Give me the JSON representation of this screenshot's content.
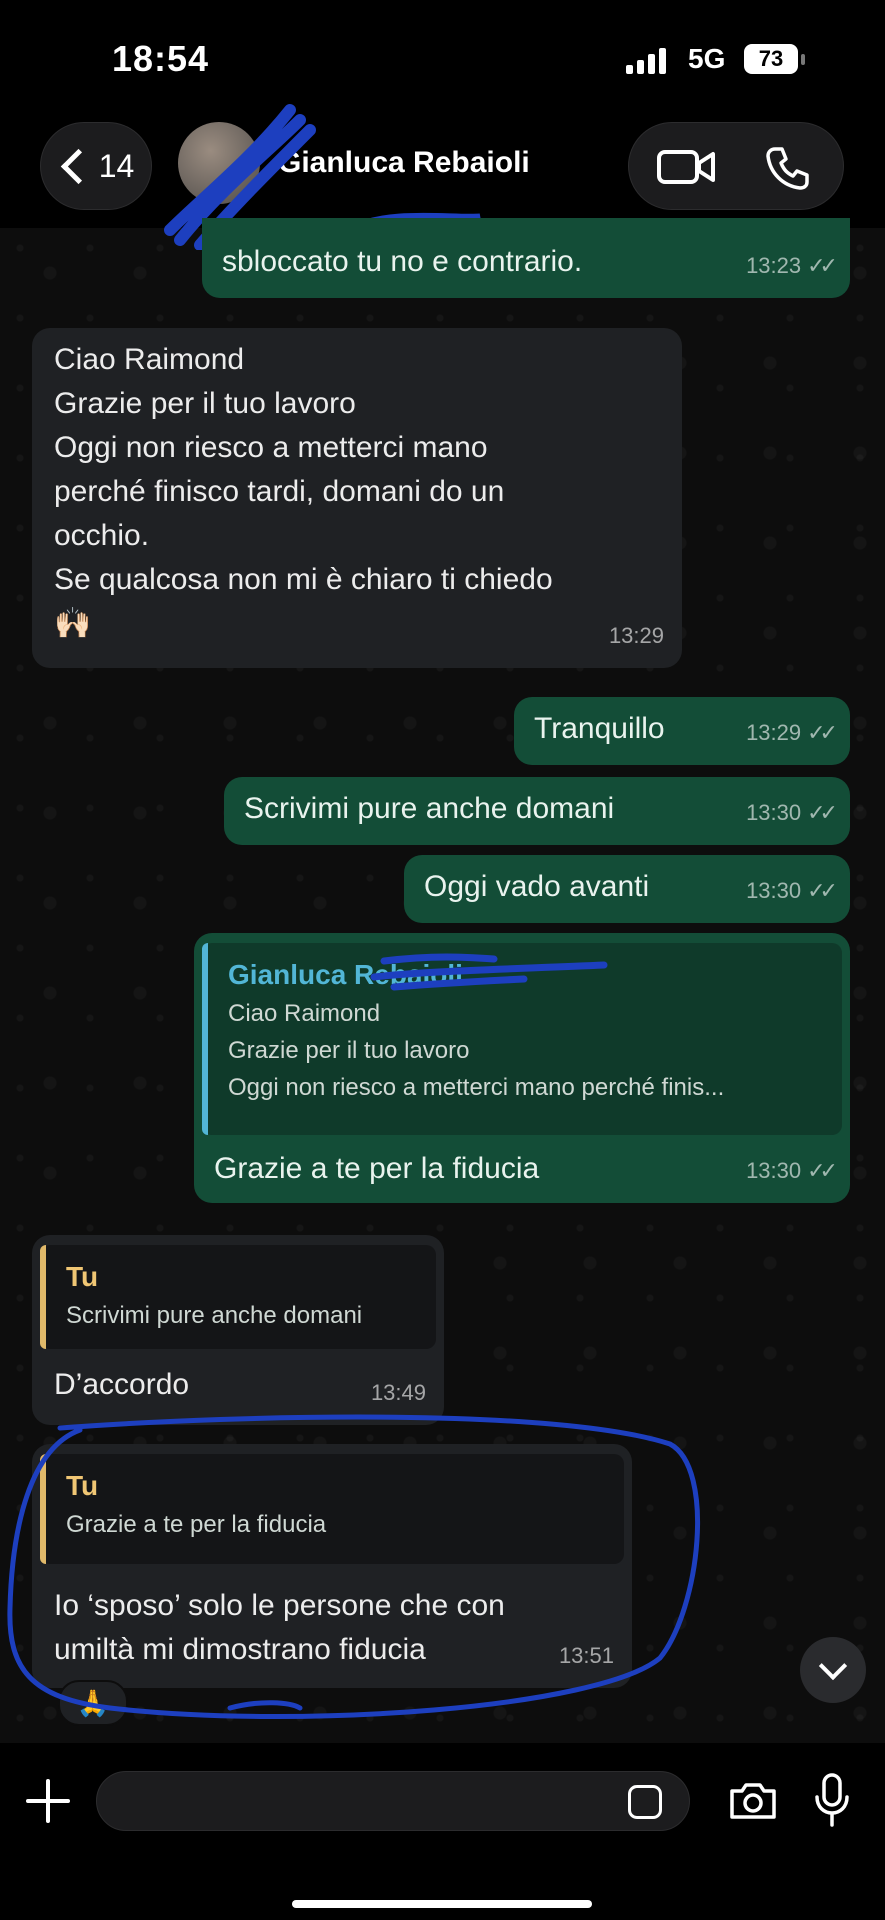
{
  "status_bar": {
    "time": "18:54",
    "network": "5G",
    "battery": "73"
  },
  "header": {
    "back_count": "14",
    "contact_name": "Gianluca Rebaioli"
  },
  "messages": [
    {
      "dir": "out",
      "text": "sbloccato tu no e contrario.",
      "time": "13:23"
    },
    {
      "dir": "in",
      "lines": [
        "Ciao Raimond",
        "Grazie per il tuo lavoro",
        "Oggi non riesco a metterci mano",
        "perché finisco tardi, domani do un",
        "occhio.",
        "Se qualcosa non mi è chiaro ti chiedo",
        "🙌🏻"
      ],
      "time": "13:29"
    },
    {
      "dir": "out",
      "text": "Tranquillo",
      "time": "13:29"
    },
    {
      "dir": "out",
      "text": "Scrivimi pure anche domani",
      "time": "13:30"
    },
    {
      "dir": "out",
      "text": "Oggi vado avanti",
      "time": "13:30"
    },
    {
      "dir": "out",
      "quote": {
        "author": "Gianluca Rebaioli",
        "lines": [
          "Ciao Raimond",
          "Grazie per il tuo lavoro",
          "Oggi non riesco a metterci mano perché finis..."
        ]
      },
      "text": "Grazie a te per la fiducia",
      "time": "13:30"
    },
    {
      "dir": "in",
      "quote": {
        "author": "Tu",
        "lines": [
          "Scrivimi pure anche domani"
        ]
      },
      "text": "D’accordo",
      "time": "13:49"
    },
    {
      "dir": "in",
      "quote": {
        "author": "Tu",
        "lines": [
          "Grazie a te per la fiducia"
        ]
      },
      "lines": [
        "Io ‘sposo’ solo le persone che con",
        "umiltà mi dimostrano fiducia"
      ],
      "time": "13:51",
      "reaction": "🙏"
    }
  ],
  "ticks": "✓✓",
  "input": {
    "value": ""
  },
  "icons": [
    "back-chevron-icon",
    "avatar",
    "video-call-icon",
    "phone-icon",
    "chevron-down-icon",
    "plus-icon",
    "sticker-icon",
    "camera-icon",
    "microphone-icon"
  ],
  "colors": {
    "outgoing_bubble": "#134d37",
    "incoming_bubble": "#1f2124",
    "quote_bar_blue": "#52b6d6",
    "quote_bar_yellow": "#e0b96a",
    "annotation": "#1d3fbf"
  }
}
